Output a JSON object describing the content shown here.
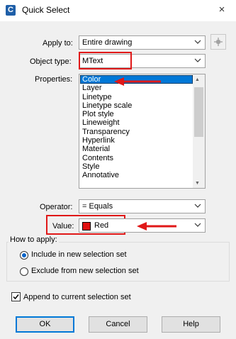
{
  "window": {
    "title": "Quick Select",
    "icon_letter": "C",
    "close": "×"
  },
  "apply_to": {
    "label": "Apply to:",
    "value": "Entire drawing"
  },
  "object_type": {
    "label": "Object type:",
    "value": "MText"
  },
  "properties": {
    "label": "Properties:",
    "items": [
      "Color",
      "Layer",
      "Linetype",
      "Linetype scale",
      "Plot style",
      "Lineweight",
      "Transparency",
      "Hyperlink",
      "Material",
      "Contents",
      "Style",
      "Annotative"
    ],
    "selected": "Color"
  },
  "operator": {
    "label": "Operator:",
    "value": "= Equals"
  },
  "value": {
    "label": "Value:",
    "value": "Red",
    "swatch_color": "#e01010"
  },
  "how_to_apply": {
    "title": "How to apply:",
    "include_label": "Include in new selection set",
    "exclude_label": "Exclude from new selection set",
    "include_selected": true
  },
  "append": {
    "label": "Append to current selection set",
    "checked": true
  },
  "buttons": {
    "ok": "OK",
    "cancel": "Cancel",
    "help": "Help"
  },
  "colors": {
    "highlight": "#e01818",
    "selection": "#0078d7"
  }
}
